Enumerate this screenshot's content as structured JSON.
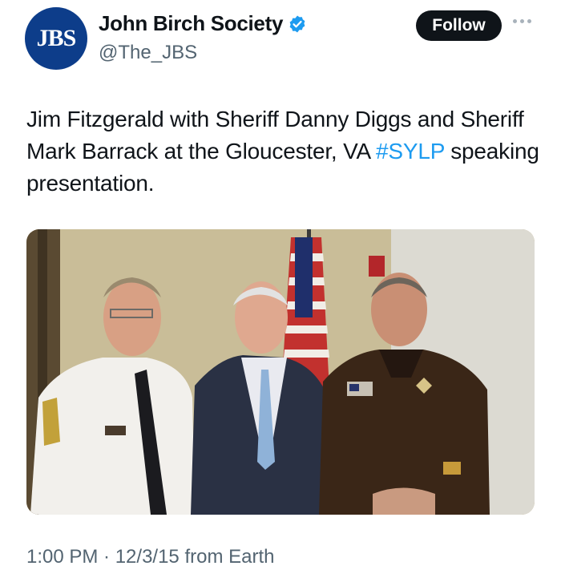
{
  "account": {
    "avatar_text": "JBS",
    "display_name": "John Birch Society",
    "handle": "@The_JBS",
    "verified": true
  },
  "actions": {
    "follow_label": "Follow",
    "more_icon": "more-horizontal-icon"
  },
  "tweet": {
    "text_before_hashtag": "Jim Fitzgerald with Sheriff Danny Diggs and Sheriff Mark Barrack at the Gloucester, VA ",
    "hashtag": "#SYLP",
    "text_after_hashtag": " speaking presentation."
  },
  "media": {
    "type": "photo"
  },
  "meta": {
    "timestamp": "1:00 PM · 12/3/15 from Earth"
  },
  "colors": {
    "link": "#1d9bf0",
    "verified": "#1d9bf0",
    "follow_bg": "#0f1419",
    "secondary_text": "#536471"
  }
}
